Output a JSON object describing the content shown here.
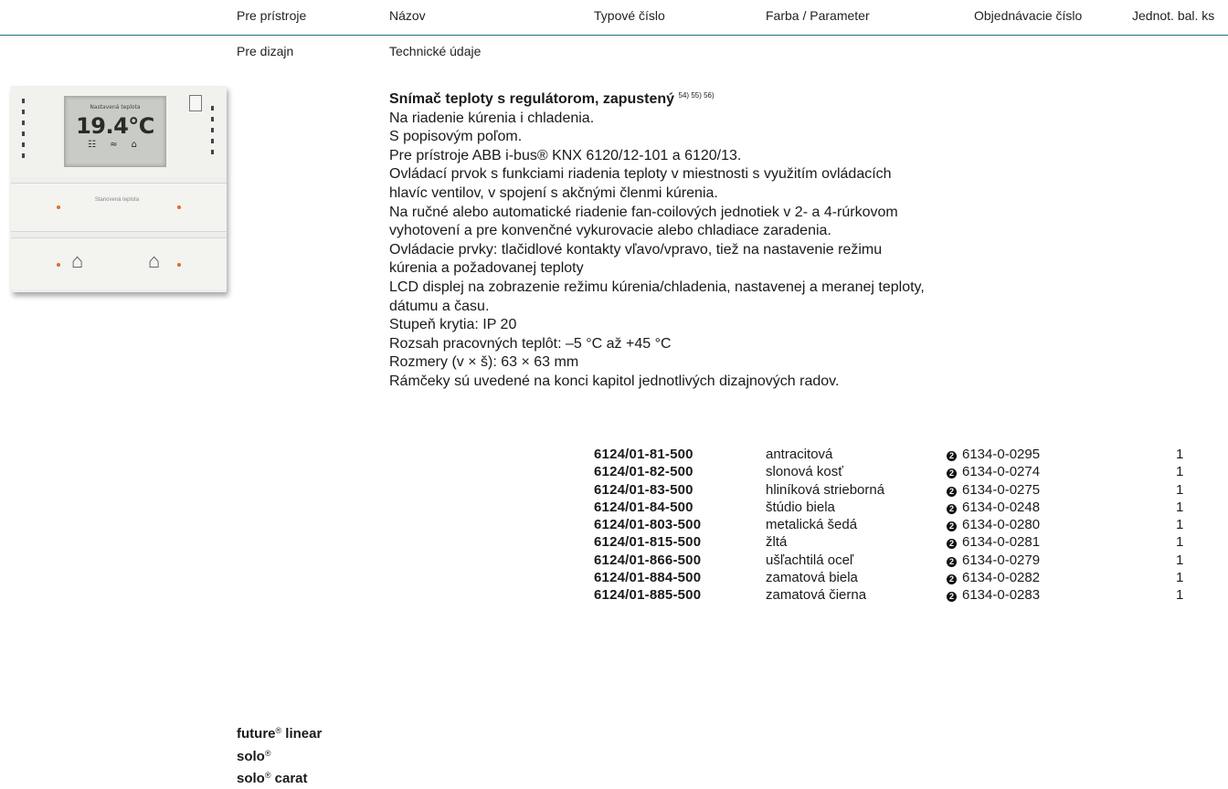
{
  "header": {
    "col_devices": "Pre prístroje",
    "col_name": "Názov",
    "col_type": "Typové číslo",
    "col_color": "Farba / Parameter",
    "col_order": "Objednávacie číslo",
    "col_unit": "Jednot. bal. ks"
  },
  "subheader": {
    "col_design": "Pre dizajn",
    "col_tech": "Technické údaje"
  },
  "device_image": {
    "lcd_heading": "Nastavená teplota",
    "lcd_temp": "19.4°C",
    "lcd_icons": "☷ ≈ ⌂",
    "button_label": "Stanovená teplota"
  },
  "description": {
    "title": "Snímač teploty s regulátorom, zapustený",
    "footnotes": "54) 55) 56)",
    "lines": [
      "Na riadenie kúrenia i chladenia.",
      "S popisovým poľom.",
      "Pre prístroje ABB i-bus® KNX 6120/12-101 a 6120/13.",
      "Ovládací prvok s funkciami riadenia teploty v miestnosti s využitím ovládacích",
      "hlavíc ventilov, v spojení s akčnými členmi kúrenia.",
      "Na ručné alebo automatické riadenie fan-coilových jednotiek v 2- a 4-rúrkovom",
      "vyhotovení a pre konvenčné vykurovacie alebo chladiace zaradenia.",
      "Ovládacie prvky: tlačidlové kontakty vľavo/vpravo, tiež na nastavenie režimu",
      "kúrenia a požadovanej teploty",
      "LCD displej na zobrazenie režimu kúrenia/chladenia, nastavenej a meranej teploty,",
      "dátumu a času.",
      "Stupeň krytia: IP 20",
      "Rozsah pracovných teplôt: –5 °C až +45 °C",
      "Rozmery (v × š): 63 × 63 mm",
      "Rámčeky sú uvedené na konci kapitol jednotlivých dizajnových radov."
    ]
  },
  "order_marker": "2",
  "variants": [
    {
      "type": "6124/01-81-500",
      "color": "antracitová",
      "order": "6134-0-0295",
      "unit": "1"
    },
    {
      "type": "6124/01-82-500",
      "color": "slonová kosť",
      "order": "6134-0-0274",
      "unit": "1"
    },
    {
      "type": "6124/01-83-500",
      "color": "hliníková strieborná",
      "order": "6134-0-0275",
      "unit": "1"
    },
    {
      "type": "6124/01-84-500",
      "color": "štúdio biela",
      "order": "6134-0-0248",
      "unit": "1"
    },
    {
      "type": "6124/01-803-500",
      "color": "metalická šedá",
      "order": "6134-0-0280",
      "unit": "1"
    },
    {
      "type": "6124/01-815-500",
      "color": "žltá",
      "order": "6134-0-0281",
      "unit": "1"
    },
    {
      "type": "6124/01-866-500",
      "color": "ušľachtilá oceľ",
      "order": "6134-0-0279",
      "unit": "1"
    },
    {
      "type": "6124/01-884-500",
      "color": "zamatová biela",
      "order": "6134-0-0282",
      "unit": "1"
    },
    {
      "type": "6124/01-885-500",
      "color": "zamatová čierna",
      "order": "6134-0-0283",
      "unit": "1"
    }
  ],
  "series": [
    {
      "name": "future",
      "mark": "®",
      "suffix": " linear"
    },
    {
      "name": "solo",
      "mark": "®",
      "suffix": ""
    },
    {
      "name": "solo",
      "mark": "®",
      "suffix": " carat"
    }
  ],
  "colors": {
    "rule": "#1f6f86",
    "led": "#e06a2a"
  }
}
